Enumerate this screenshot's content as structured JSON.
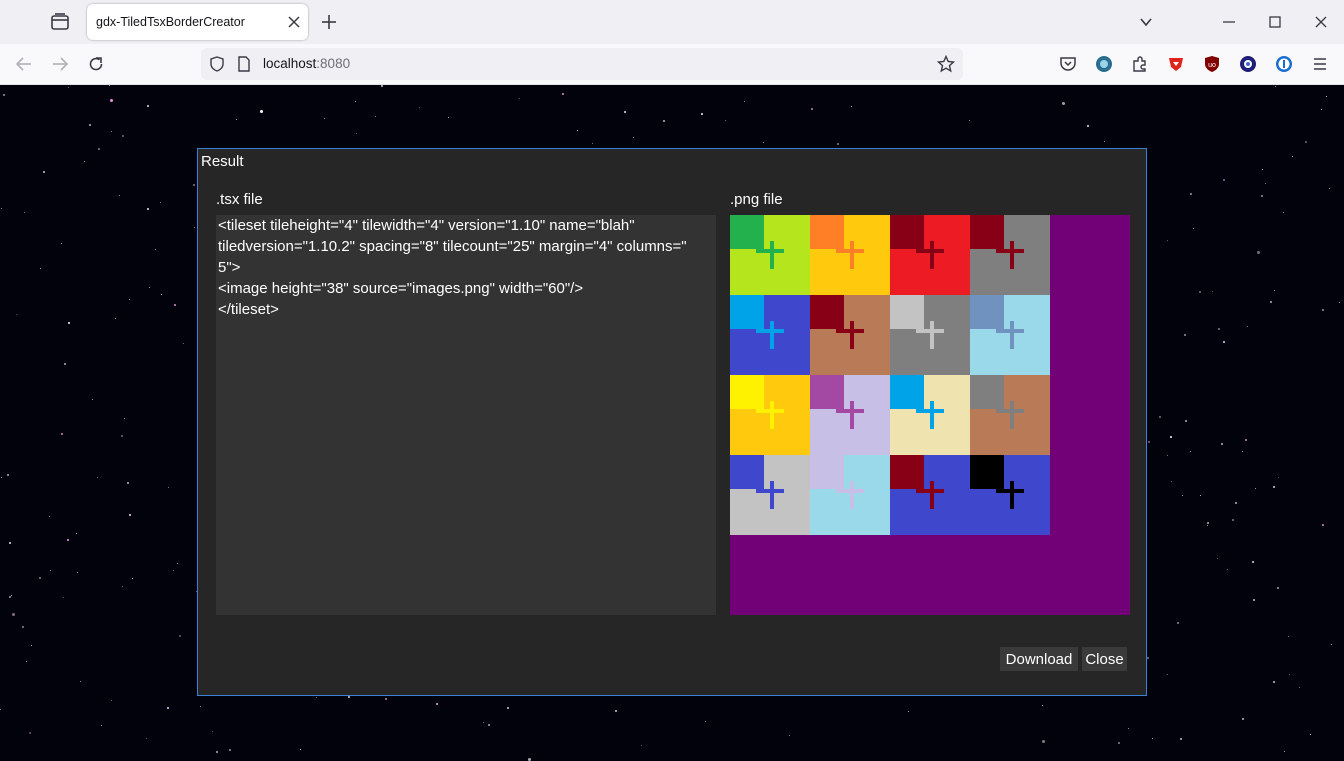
{
  "browser": {
    "tab_title": "gdx-TiledTsxBorderCreator",
    "url_host": "localhost",
    "url_port": ":8080",
    "accent": "#0060df"
  },
  "icons": {
    "tab_list": "tab-list-icon",
    "new_tab": "plus-icon",
    "back": "back-arrow-icon",
    "forward": "forward-arrow-icon",
    "reload": "reload-icon",
    "shield": "shield-icon",
    "page": "page-icon",
    "bookmark": "star-icon",
    "pocket": "pocket-icon",
    "account": "account-icon",
    "extensions": "puzzle-icon",
    "menu": "hamburger-menu-icon"
  },
  "dialog": {
    "title": "Result",
    "tsx_label": ".tsx file",
    "png_label": ".png file",
    "tsx_lines": [
      "<tileset tileheight=\"4\" tilewidth=\"4\" version=\"1.10\" name=\"blah\"",
      "tiledversion=\"1.10.2\" spacing=\"8\" tilecount=\"25\" margin=\"4\" columns=\"",
      "5\">",
      "<image height=\"38\" source=\"images.png\" width=\"60\"/>",
      "</tileset>"
    ],
    "download_label": "Download",
    "close_label": "Close",
    "border_color": "#3b82d6",
    "png_background": "#720178"
  },
  "tiles": [
    {
      "a": "#22b14c",
      "b": "#b5e61d",
      "c": "#b5e61d"
    },
    {
      "a": "#ff7f27",
      "b": "#ffc90e",
      "c": "#ffc90e"
    },
    {
      "a": "#880015",
      "b": "#ed1c24",
      "c": "#ed1c24"
    },
    {
      "a": "#880015",
      "b": "#7f7f7f",
      "c": "#7f7f7f"
    },
    {
      "a": "#00a2e8",
      "b": "#3f48cc",
      "c": "#3f48cc"
    },
    {
      "a": "#880015",
      "b": "#b97a57",
      "c": "#b97a57"
    },
    {
      "a": "#c3c3c3",
      "b": "#7f7f7f",
      "c": "#7f7f7f"
    },
    {
      "a": "#7092be",
      "b": "#99d9ea",
      "c": "#99d9ea"
    },
    {
      "a": "#fff200",
      "b": "#ffc90e",
      "c": "#ffc90e"
    },
    {
      "a": "#a349a4",
      "b": "#c8bfe7",
      "c": "#c8bfe7"
    },
    {
      "a": "#00a2e8",
      "b": "#efe4b0",
      "c": "#efe4b0"
    },
    {
      "a": "#7f7f7f",
      "b": "#b97a57",
      "c": "#b97a57"
    },
    {
      "a": "#3f48cc",
      "b": "#c3c3c3",
      "c": "#c3c3c3"
    },
    {
      "a": "#c8bfe7",
      "b": "#99d9ea",
      "c": "#99d9ea"
    },
    {
      "a": "#880015",
      "b": "#3f48cc",
      "c": "#3f48cc"
    },
    {
      "a": "#000000",
      "b": "#3f48cc",
      "c": "#3f48cc"
    }
  ]
}
